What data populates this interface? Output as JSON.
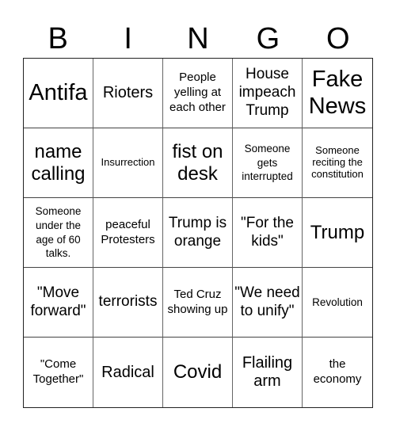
{
  "header": {
    "letters": [
      "B",
      "I",
      "N",
      "G",
      "O"
    ]
  },
  "cells": [
    {
      "text": "Antifa",
      "size": "s-xl"
    },
    {
      "text": "Rioters",
      "size": "s-m"
    },
    {
      "text": "People yelling at each other",
      "size": "s-s"
    },
    {
      "text": "House impeach Trump",
      "size": "s-ml"
    },
    {
      "text": "Fake News",
      "size": "s-xl"
    },
    {
      "text": "name calling",
      "size": "s-l"
    },
    {
      "text": "Insurrection",
      "size": "s-xxs"
    },
    {
      "text": "fist on desk",
      "size": "s-l"
    },
    {
      "text": "Someone gets interrupted",
      "size": "s-xs"
    },
    {
      "text": "Someone reciting the constitution",
      "size": "s-xxs"
    },
    {
      "text": "Someone under the age of 60 talks.",
      "size": "s-xs"
    },
    {
      "text": "peaceful Protesters",
      "size": "s-s"
    },
    {
      "text": "Trump is orange",
      "size": "s-ml"
    },
    {
      "text": "\"For the kids\"",
      "size": "s-ml"
    },
    {
      "text": "Trump",
      "size": "s-l"
    },
    {
      "text": "\"Move forward\"",
      "size": "s-ml"
    },
    {
      "text": "terrorists",
      "size": "s-ml"
    },
    {
      "text": "Ted Cruz showing up",
      "size": "s-s"
    },
    {
      "text": "\"We need to unify\"",
      "size": "s-ml"
    },
    {
      "text": "Revolution",
      "size": "s-xs"
    },
    {
      "text": "\"Come Together\"",
      "size": "s-s"
    },
    {
      "text": "Radical",
      "size": "s-m"
    },
    {
      "text": "Covid",
      "size": "s-l"
    },
    {
      "text": "Flailing arm",
      "size": "s-m"
    },
    {
      "text": "the economy",
      "size": "s-s"
    }
  ]
}
